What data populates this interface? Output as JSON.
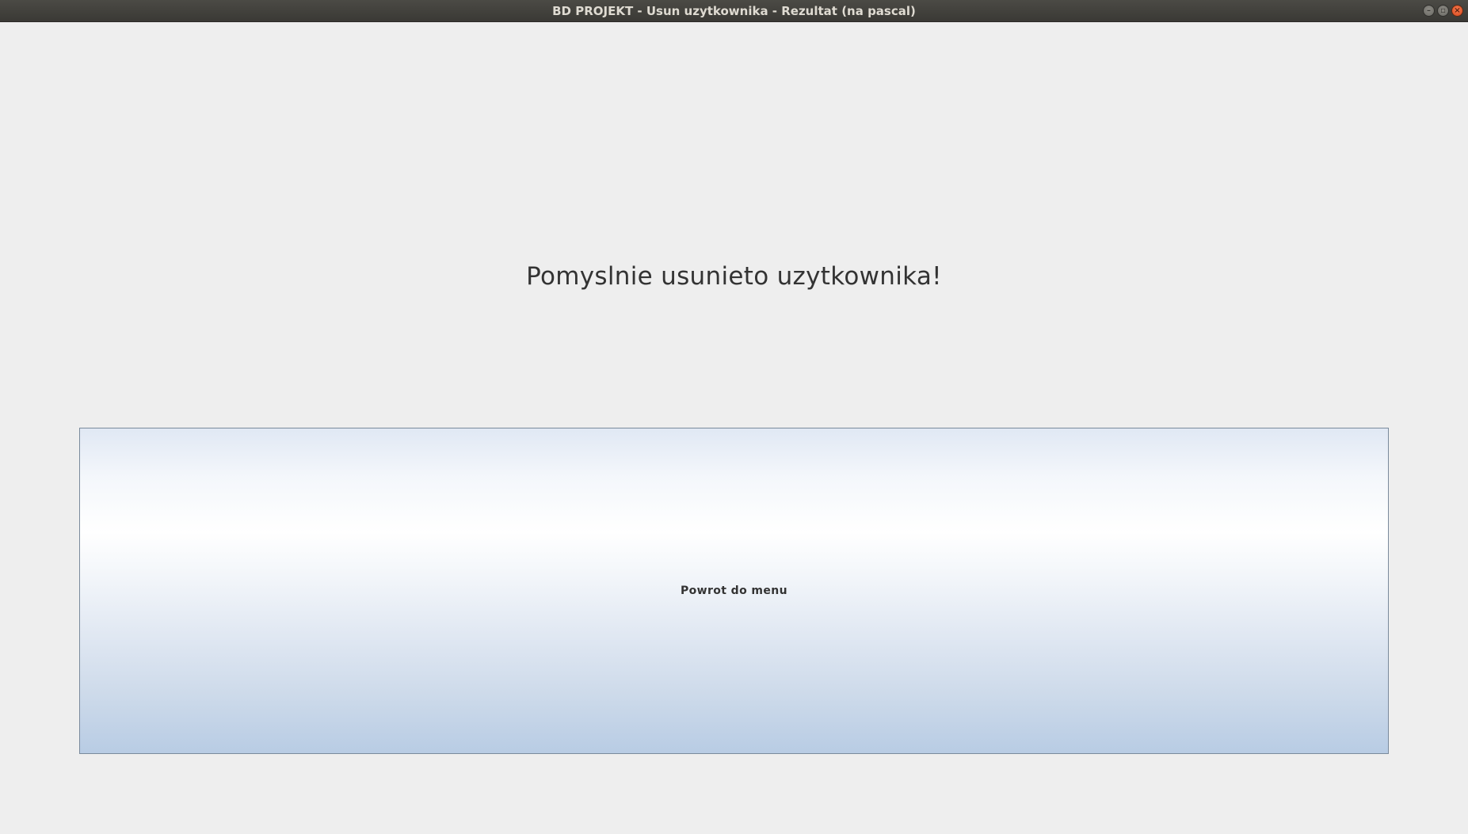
{
  "window": {
    "title": "BD PROJEKT - Usun uzytkownika - Rezultat (na pascal)",
    "controls": {
      "minimize_icon": "minimize-icon",
      "maximize_icon": "maximize-icon",
      "close_icon": "close-icon",
      "minimize_glyph": "–",
      "maximize_glyph": "▫",
      "close_glyph": "×"
    }
  },
  "main": {
    "message": "Pomyslnie usunieto uzytkownika!",
    "back_button_label": "Powrot do menu"
  },
  "colors": {
    "background": "#eeeeee",
    "titlebar": "#3f3e3a",
    "close_button": "#e65a2b",
    "button_gradient_top": "#e0e8f4",
    "button_gradient_bottom": "#b8cce4"
  }
}
